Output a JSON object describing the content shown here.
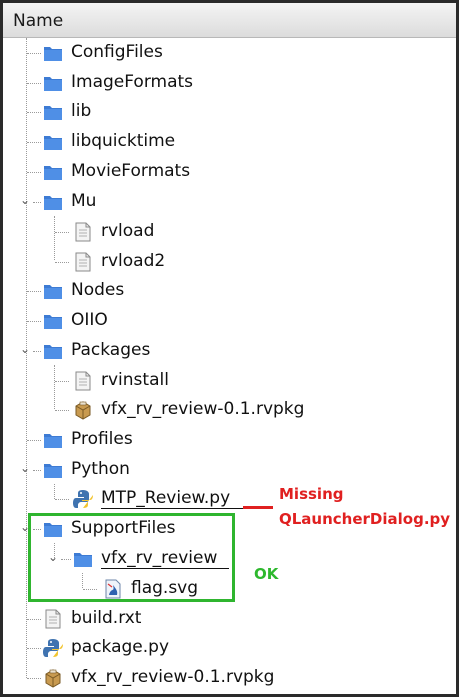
{
  "header": {
    "name_label": "Name"
  },
  "tree": {
    "items": [
      {
        "label": "ConfigFiles",
        "type": "folder"
      },
      {
        "label": "ImageFormats",
        "type": "folder"
      },
      {
        "label": "lib",
        "type": "folder"
      },
      {
        "label": "libquicktime",
        "type": "folder"
      },
      {
        "label": "MovieFormats",
        "type": "folder"
      },
      {
        "label": "Mu",
        "type": "folder",
        "expanded": true
      },
      {
        "label": "rvload",
        "type": "file"
      },
      {
        "label": "rvload2",
        "type": "file"
      },
      {
        "label": "Nodes",
        "type": "folder"
      },
      {
        "label": "OIIO",
        "type": "folder"
      },
      {
        "label": "Packages",
        "type": "folder",
        "expanded": true
      },
      {
        "label": "rvinstall",
        "type": "file"
      },
      {
        "label": "vfx_rv_review-0.1.rvpkg",
        "type": "package"
      },
      {
        "label": "Profiles",
        "type": "folder"
      },
      {
        "label": "Python",
        "type": "folder",
        "expanded": true
      },
      {
        "label": "MTP_Review.py",
        "type": "python"
      },
      {
        "label": "SupportFiles",
        "type": "folder",
        "expanded": true
      },
      {
        "label": "vfx_rv_review",
        "type": "folder",
        "expanded": true
      },
      {
        "label": "flag.svg",
        "type": "svg"
      },
      {
        "label": "build.rxt",
        "type": "file"
      },
      {
        "label": "package.py",
        "type": "python"
      },
      {
        "label": "vfx_rv_review-0.1.rvpkg",
        "type": "package"
      }
    ]
  },
  "annotations": {
    "missing_line1": "Missing",
    "missing_line2": "QLauncherDialog.py",
    "ok": "OK"
  },
  "colors": {
    "folder": "#3d7bd4",
    "annotation_red": "#e02020",
    "annotation_green": "#2fb52f"
  }
}
